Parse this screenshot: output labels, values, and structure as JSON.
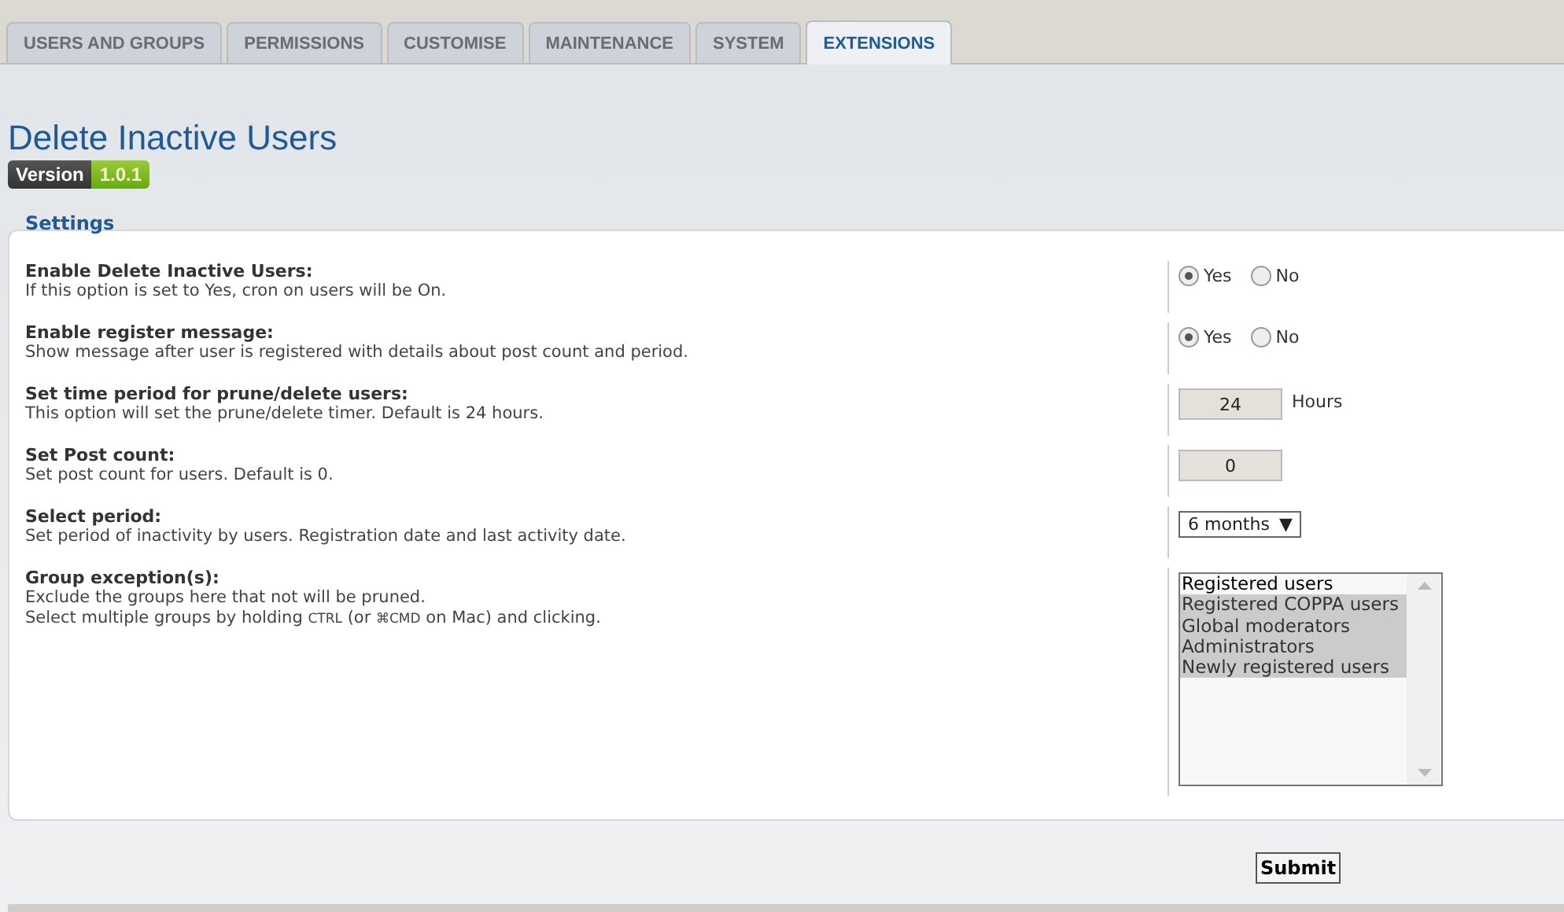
{
  "tabs": [
    {
      "label": "USERS AND GROUPS",
      "selected": false
    },
    {
      "label": "PERMISSIONS",
      "selected": false
    },
    {
      "label": "CUSTOMISE",
      "selected": false
    },
    {
      "label": "MAINTENANCE",
      "selected": false
    },
    {
      "label": "SYSTEM",
      "selected": false
    },
    {
      "label": "EXTENSIONS",
      "selected": true
    }
  ],
  "title": "Delete Inactive Users",
  "version": {
    "label": "Version",
    "number": "1.0.1"
  },
  "settings": {
    "legend": "Settings",
    "rows": [
      {
        "label": "Enable Delete Inactive Users:",
        "description": [
          [
            {
              "text": "If this option is set to Yes, cron on users will be On.",
              "kind": "plain"
            }
          ]
        ],
        "control": {
          "kind": "radio",
          "options": [
            {
              "label": "Yes",
              "selected": true
            },
            {
              "label": "No",
              "selected": false
            }
          ]
        }
      },
      {
        "label": "Enable register message:",
        "description": [
          [
            {
              "text": "Show message after user is registered with details about post count and period.",
              "kind": "plain"
            }
          ]
        ],
        "control": {
          "kind": "radio",
          "options": [
            {
              "label": "Yes",
              "selected": true
            },
            {
              "label": "No",
              "selected": false
            }
          ]
        }
      },
      {
        "label": "Set time period for prune/delete users:",
        "description": [
          [
            {
              "text": "This option will set the prune/delete timer. Default is 24 hours.",
              "kind": "plain"
            }
          ]
        ],
        "control": {
          "kind": "number",
          "value": "24",
          "unit": "Hours"
        }
      },
      {
        "label": "Set Post count:",
        "description": [
          [
            {
              "text": "Set post count for users. Default is 0.",
              "kind": "plain"
            }
          ]
        ],
        "control": {
          "kind": "number",
          "value": "0"
        }
      },
      {
        "label": "Select period:",
        "description": [
          [
            {
              "text": "Set period of inactivity by users. Registration date and last activity date.",
              "kind": "plain"
            }
          ]
        ],
        "control": {
          "kind": "select",
          "value": "6 months",
          "caret": "▼"
        }
      },
      {
        "label": "Group exception(s):",
        "description": [
          [
            {
              "text": "Exclude the groups here that not will be pruned.",
              "kind": "plain"
            }
          ],
          [
            {
              "text": "Select multiple groups by holding ",
              "kind": "plain"
            },
            {
              "text": "CTRL",
              "kind": "key"
            },
            {
              "text": " (or ",
              "kind": "plain"
            },
            {
              "text": "⌘CMD",
              "kind": "key"
            },
            {
              "text": " on Mac) and clicking.",
              "kind": "plain"
            }
          ]
        ],
        "control": {
          "kind": "multiselect",
          "options": [
            {
              "label": "Registered users",
              "selected": false
            },
            {
              "label": "Registered COPPA users",
              "selected": true
            },
            {
              "label": "Global moderators",
              "selected": true
            },
            {
              "label": "Administrators",
              "selected": true
            },
            {
              "label": "Newly registered users",
              "selected": true
            }
          ]
        }
      }
    ]
  },
  "submit": "Submit"
}
